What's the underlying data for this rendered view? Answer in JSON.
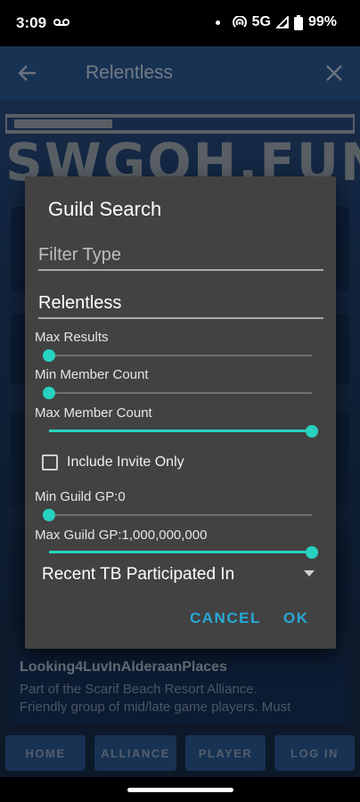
{
  "status_bar": {
    "time": "3:09",
    "network": "5G",
    "battery": "99%"
  },
  "app": {
    "title": "Relentless",
    "logo_text": "SWGOH.FUN",
    "guild_card": {
      "name": "Looking4LuvInAlderaanPlaces",
      "description_line1": "Part of the Scarif Beach Resort Alliance.",
      "description_line2": "Friendly group of mid/late game players.  Must"
    },
    "nav": {
      "home": "HOME",
      "alliance": "ALLIANCE",
      "player": "PLAYER",
      "login": "LOG IN"
    }
  },
  "dialog": {
    "title": "Guild Search",
    "filter_type_placeholder": "Filter Type",
    "search_value": "Relentless",
    "max_results_label": "Max Results",
    "max_results_fraction": 0.0,
    "min_member_label": "Min Member Count",
    "min_member_fraction": 0.0,
    "max_member_label": "Max Member Count",
    "max_member_fraction": 1.0,
    "include_invite_only_label": "Include Invite Only",
    "include_invite_only_checked": false,
    "min_gp_label": "Min Guild GP:0",
    "min_gp_fraction": 0.0,
    "max_gp_label": "Max Guild GP:1,000,000,000",
    "max_gp_fraction": 1.0,
    "tb_select_value": "Recent TB Participated In",
    "cancel_label": "CANCEL",
    "ok_label": "OK"
  },
  "colors": {
    "accent": "#27d3c0",
    "button_text": "#27a9d8",
    "dialog_bg": "#424242",
    "header_bg": "#2a5690"
  }
}
